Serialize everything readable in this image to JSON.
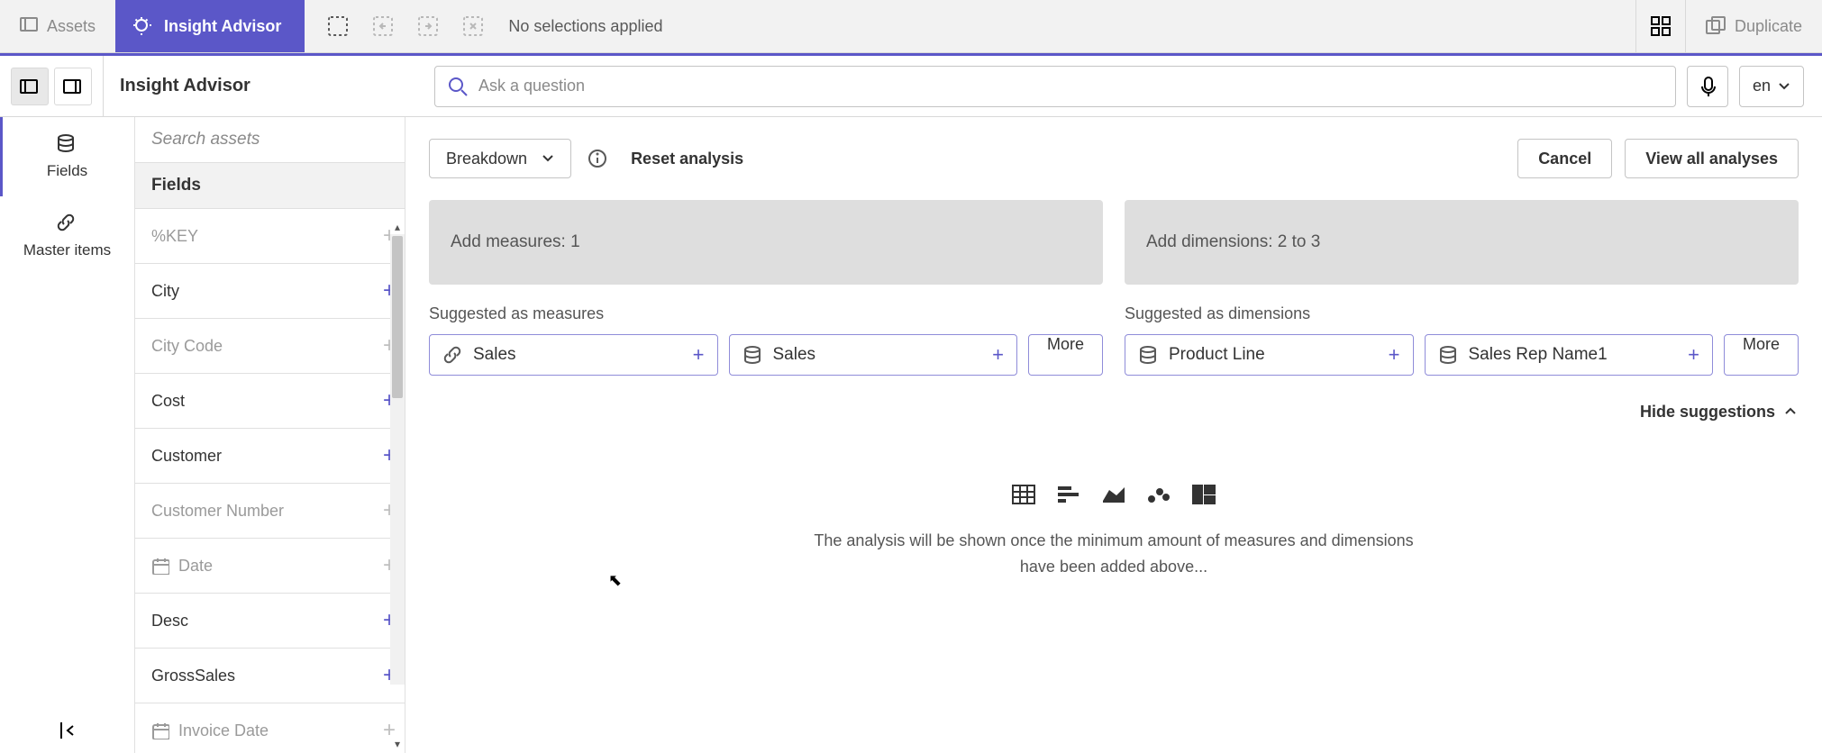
{
  "topbar": {
    "assets_tab": "Assets",
    "insight_tab": "Insight Advisor",
    "no_selections": "No selections applied",
    "duplicate": "Duplicate"
  },
  "header": {
    "title": "Insight Advisor",
    "search_placeholder": "Ask a question",
    "language": "en"
  },
  "left_rail": {
    "fields": "Fields",
    "master_items": "Master items"
  },
  "assets": {
    "search_placeholder": "Search assets",
    "header": "Fields",
    "items": [
      {
        "label": "%KEY",
        "disabled": true
      },
      {
        "label": "City",
        "disabled": false
      },
      {
        "label": "City Code",
        "disabled": true
      },
      {
        "label": "Cost",
        "disabled": false
      },
      {
        "label": "Customer",
        "disabled": false
      },
      {
        "label": "Customer Number",
        "disabled": true
      },
      {
        "label": "Date",
        "disabled": true,
        "icon": "calendar"
      },
      {
        "label": "Desc",
        "disabled": false
      },
      {
        "label": "GrossSales",
        "disabled": false
      },
      {
        "label": "Invoice Date",
        "disabled": true,
        "icon": "calendar"
      }
    ]
  },
  "main": {
    "analysis_type": "Breakdown",
    "reset": "Reset analysis",
    "cancel": "Cancel",
    "view_all": "View all analyses",
    "add_measures": "Add measures: 1",
    "add_dimensions": "Add dimensions: 2 to 3",
    "suggested_measures_title": "Suggested as measures",
    "suggested_dimensions_title": "Suggested as dimensions",
    "more": "More",
    "hide_suggestions": "Hide suggestions",
    "placeholder_text": "The analysis will be shown once the minimum amount of measures and dimensions have been added above...",
    "suggested_measures": [
      {
        "label": "Sales",
        "icon": "link"
      },
      {
        "label": "Sales",
        "icon": "db"
      }
    ],
    "suggested_dimensions": [
      {
        "label": "Product Line",
        "icon": "db"
      },
      {
        "label": "Sales Rep Name1",
        "icon": "db"
      }
    ]
  }
}
